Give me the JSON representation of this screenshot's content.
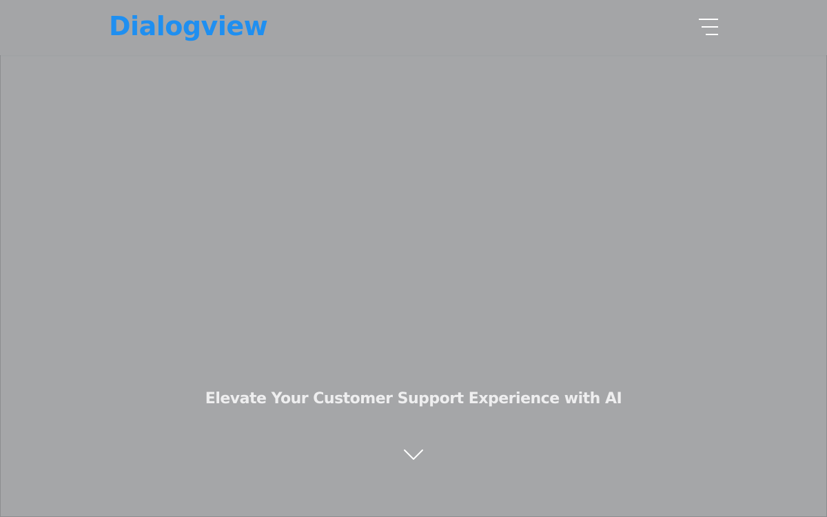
{
  "header": {
    "logo_text": "Dialogview",
    "menu_icon": "hamburger-menu-icon"
  },
  "hero": {
    "title": "Elevate Your Customer Support Experience with AI",
    "scroll_icon": "chevron-down-icon"
  },
  "colors": {
    "background": "#a5a6a8",
    "logo": "#1f8ff0",
    "hero_text": "#eeeeef",
    "icon": "#ffffff"
  }
}
